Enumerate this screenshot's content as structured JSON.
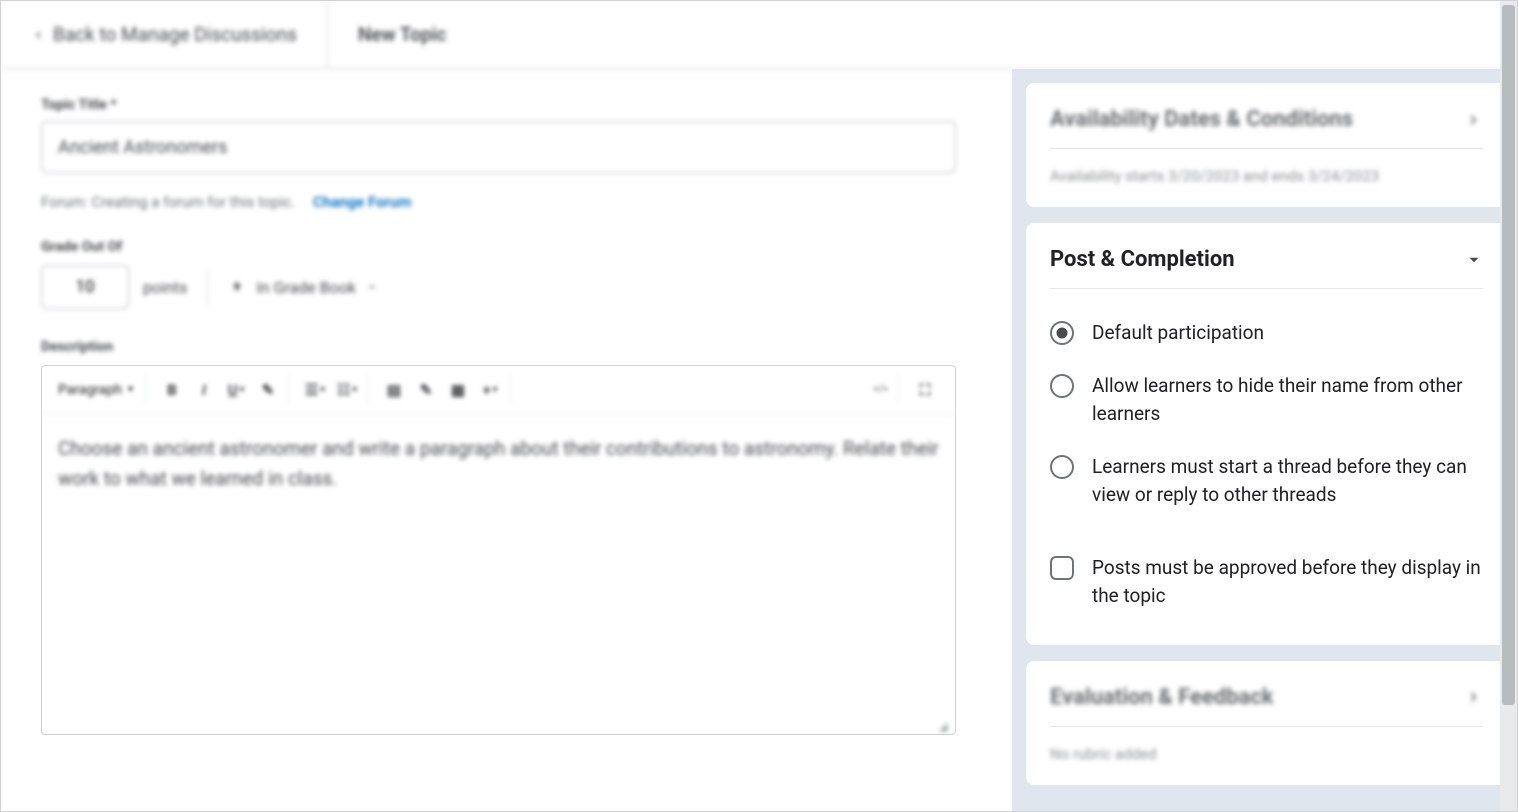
{
  "header": {
    "back_label": "Back to Manage Discussions",
    "tab_label": "New Topic"
  },
  "main": {
    "title_label": "Topic Title *",
    "title_value": "Ancient Astronomers",
    "forum_prefix": "Forum: Creating a forum for this topic.",
    "change_forum": "Change Forum",
    "grade_label": "Grade Out Of",
    "grade_value": "10",
    "points_label": "points",
    "gradebook_label": "In Grade Book",
    "desc_label": "Description",
    "toolbar": {
      "paragraph": "Paragraph"
    },
    "desc_body": "Choose an ancient astronomer and write a paragraph about their contributions to astronomy. Relate their work to what we learned in class."
  },
  "side": {
    "availability": {
      "title": "Availability Dates & Conditions",
      "summary": "Availability starts 3/20/2023 and ends 3/24/2023"
    },
    "post_completion": {
      "title": "Post & Completion",
      "options": [
        "Default participation",
        "Allow learners to hide their name from other learners",
        "Learners must start a thread before they can view or reply to other threads"
      ],
      "checkbox": "Posts must be approved before they display in the topic"
    },
    "evaluation": {
      "title": "Evaluation & Feedback",
      "summary": "No rubric added"
    }
  }
}
